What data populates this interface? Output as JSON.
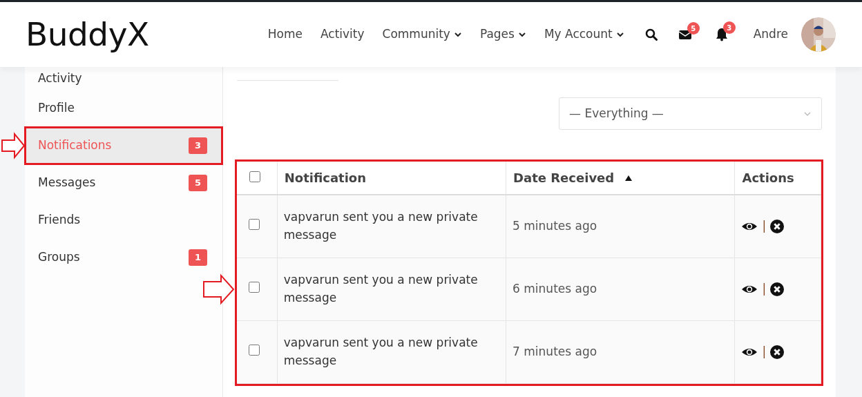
{
  "header": {
    "logo": "BuddyX",
    "nav": [
      {
        "label": "Home",
        "dropdown": false
      },
      {
        "label": "Activity",
        "dropdown": false
      },
      {
        "label": "Community",
        "dropdown": true
      },
      {
        "label": "Pages",
        "dropdown": true
      },
      {
        "label": "My Account",
        "dropdown": true
      }
    ],
    "messages_badge": "5",
    "notifications_badge": "3",
    "user_name": "Andre"
  },
  "sidebar": {
    "items": [
      {
        "label": "Activity",
        "selected": false,
        "highlighted": false,
        "pointer_arrow": false
      },
      {
        "label": "Profile",
        "selected": false,
        "highlighted": false,
        "pointer_arrow": false
      },
      {
        "label": "Notifications",
        "badge": "3",
        "selected": true,
        "highlighted": true,
        "pointer_arrow": true
      },
      {
        "label": "Messages",
        "badge": "5",
        "selected": false,
        "highlighted": false,
        "pointer_arrow": false
      },
      {
        "label": "Friends",
        "selected": false,
        "highlighted": false,
        "pointer_arrow": false
      },
      {
        "label": "Groups",
        "badge": "1",
        "selected": false,
        "highlighted": false,
        "pointer_arrow": false
      }
    ]
  },
  "filter": {
    "value": "— Everything —"
  },
  "table": {
    "highlighted": true,
    "select_all_checked": false,
    "columns": [
      "Notification",
      "Date Received",
      "Actions"
    ],
    "sort_ascending": true,
    "rows": [
      {
        "checked": false,
        "notification": "vapvarun sent you a new private message",
        "date": "5 minutes ago",
        "separator": "|",
        "pointer_arrow": false
      },
      {
        "checked": false,
        "notification": "vapvarun sent you a new private message",
        "date": "6 minutes ago",
        "separator": "|",
        "pointer_arrow": true
      },
      {
        "checked": false,
        "notification": "vapvarun sent you a new private message",
        "date": "7 minutes ago",
        "separator": "|",
        "pointer_arrow": false
      }
    ]
  }
}
